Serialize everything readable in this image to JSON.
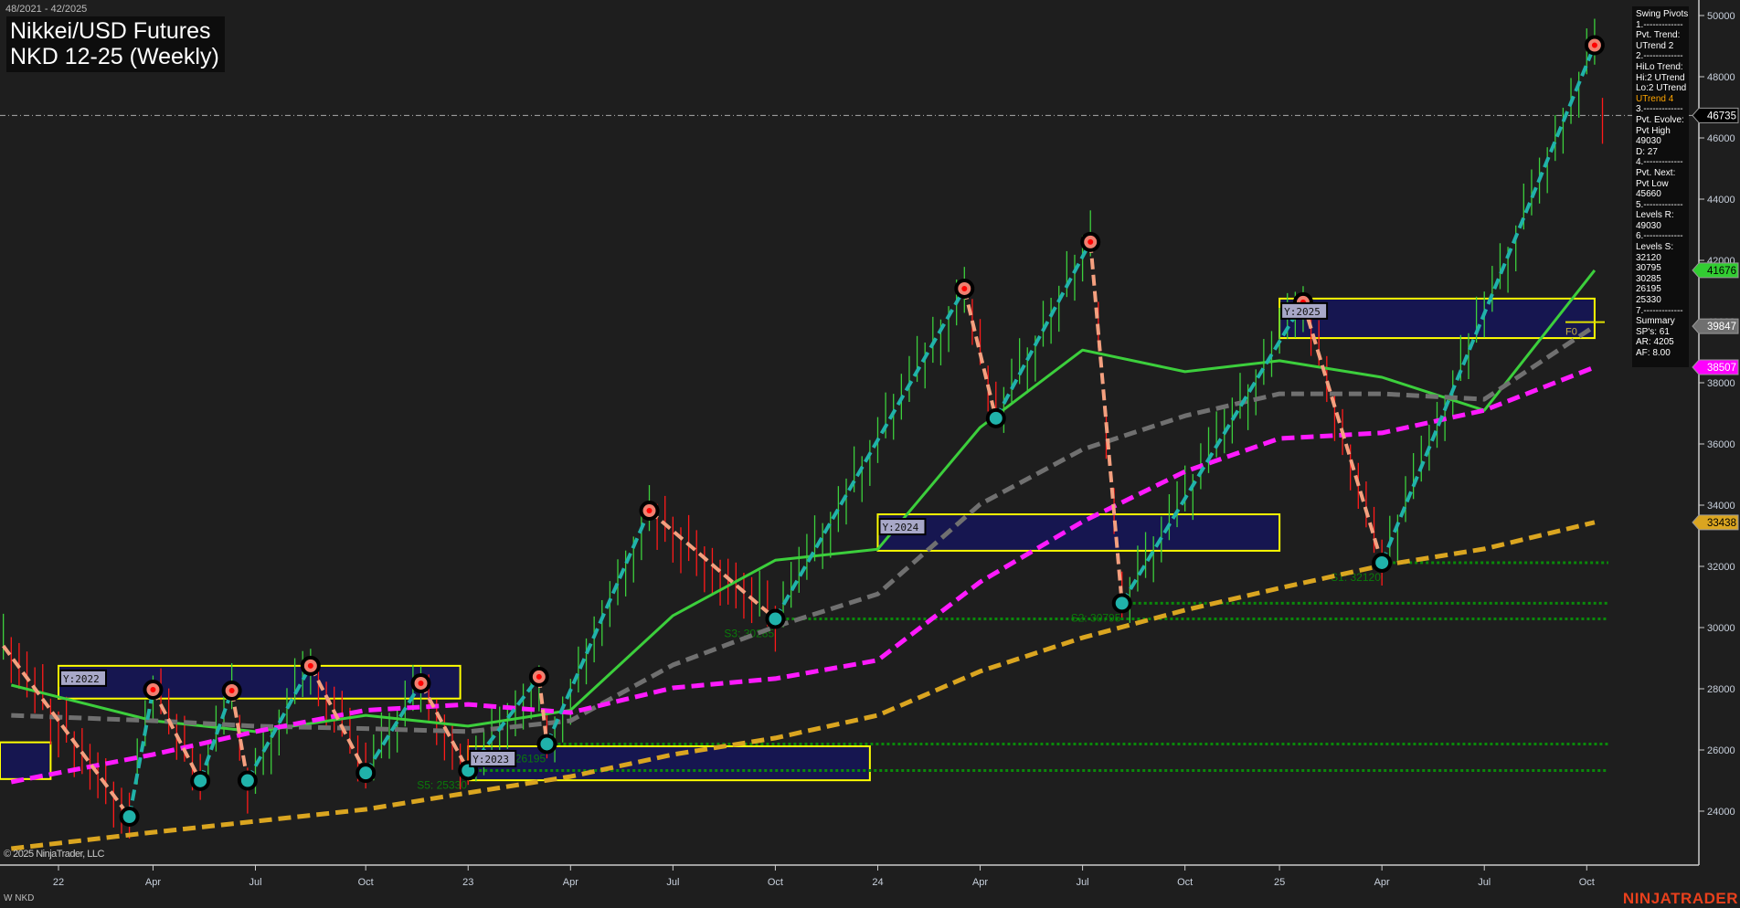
{
  "header": {
    "date_range": "48/2021 - 42/2025",
    "title_line1": "Nikkei/USD Futures",
    "title_line2": "NKD 12-25 (Weekly)"
  },
  "panel": {
    "lines": [
      "Swing Pivots",
      "1.-------------",
      "Pvt. Trend:",
      "UTrend 2",
      "2.-------------",
      "HiLo Trend:",
      "Hi:2 UTrend",
      "Lo:2 UTrend",
      "UTrend 4",
      "3.-------------",
      "Pvt. Evolve:",
      "Pvt High",
      "49030",
      "D: 27",
      "4.-------------",
      "Pvt. Next:",
      "Pvt Low",
      "45660",
      "5.-------------",
      "Levels R:",
      "49030",
      "6.-------------",
      "Levels S:",
      "32120",
      "30795",
      "30285",
      "26195",
      "25330",
      "7.-------------",
      "Summary",
      "SP's: 61",
      "AR: 4205",
      "AF: 8.00"
    ],
    "highlight_index": 8,
    "highlight_color": "#ffa500"
  },
  "footer": {
    "copyright": "© 2025 NinjaTrader, LLC",
    "instrument": "W NKD",
    "brand": "NINJATRADER"
  },
  "chart_data": {
    "type": "line",
    "title": "Nikkei/USD Futures NKD 12-25 (Weekly)",
    "x_unit": "weeks since Jan 2022",
    "ylim": [
      22500,
      50500
    ],
    "grid": false,
    "y_ticks": [
      24000,
      26000,
      28000,
      30000,
      32000,
      34000,
      36000,
      38000,
      40000,
      42000,
      44000,
      46000,
      48000,
      50000
    ],
    "x_ticks": [
      {
        "label": "22",
        "week": 0
      },
      {
        "label": "Apr",
        "week": 12
      },
      {
        "label": "Jul",
        "week": 25
      },
      {
        "label": "Oct",
        "week": 39
      },
      {
        "label": "23",
        "week": 52
      },
      {
        "label": "Apr",
        "week": 65
      },
      {
        "label": "Jul",
        "week": 78
      },
      {
        "label": "Oct",
        "week": 91
      },
      {
        "label": "24",
        "week": 104
      },
      {
        "label": "Apr",
        "week": 117
      },
      {
        "label": "Jul",
        "week": 130
      },
      {
        "label": "Oct",
        "week": 143
      },
      {
        "label": "25",
        "week": 155
      },
      {
        "label": "Apr",
        "week": 168
      },
      {
        "label": "Jul",
        "week": 181
      },
      {
        "label": "Oct",
        "week": 194
      }
    ],
    "last_price": 46735,
    "price_tags": [
      {
        "name": "last-price",
        "value": 46735,
        "bg": "#000000",
        "fg": "#ffffff"
      },
      {
        "name": "green-ma",
        "value": 41676,
        "bg": "#32cd32",
        "fg": "#000000"
      },
      {
        "name": "gray-ma",
        "value": 39847,
        "bg": "#707070",
        "fg": "#ffffff"
      },
      {
        "name": "magenta-ma",
        "value": 38507,
        "bg": "#ff00ff",
        "fg": "#ffffff"
      },
      {
        "name": "gold-ma",
        "value": 33438,
        "bg": "#daa520",
        "fg": "#000000"
      }
    ],
    "swing_pivots": [
      {
        "week": -7,
        "price": 29400,
        "type": "start"
      },
      {
        "week": 9,
        "price": 23820,
        "type": "low"
      },
      {
        "week": 12,
        "price": 27970,
        "type": "high"
      },
      {
        "week": 18,
        "price": 24990,
        "type": "low"
      },
      {
        "week": 22,
        "price": 27940,
        "type": "high"
      },
      {
        "week": 24,
        "price": 25000,
        "type": "low"
      },
      {
        "week": 32,
        "price": 28750,
        "type": "high"
      },
      {
        "week": 39,
        "price": 25250,
        "type": "low"
      },
      {
        "week": 46,
        "price": 28180,
        "type": "high"
      },
      {
        "week": 52,
        "price": 25330,
        "type": "low"
      },
      {
        "week": 61,
        "price": 28390,
        "type": "high"
      },
      {
        "week": 62,
        "price": 26195,
        "type": "low"
      },
      {
        "week": 75,
        "price": 33820,
        "type": "high"
      },
      {
        "week": 91,
        "price": 30285,
        "type": "low"
      },
      {
        "week": 115,
        "price": 41075,
        "type": "high"
      },
      {
        "week": 119,
        "price": 36840,
        "type": "low"
      },
      {
        "week": 131,
        "price": 42600,
        "type": "high"
      },
      {
        "week": 135,
        "price": 30795,
        "type": "low"
      },
      {
        "week": 158,
        "price": 40630,
        "type": "high"
      },
      {
        "week": 168,
        "price": 32120,
        "type": "low"
      },
      {
        "week": 195,
        "price": 49030,
        "type": "high"
      },
      {
        "week": 196,
        "price": 46735,
        "type": "end"
      }
    ],
    "ma_weeks": [
      -6,
      12,
      25,
      39,
      52,
      65,
      78,
      91,
      104,
      117,
      130,
      143,
      155,
      168,
      181,
      195
    ],
    "series": [
      {
        "name": "green-ma",
        "color": "#3ccf3c",
        "style": "solid",
        "values": [
          28120,
          26955,
          26600,
          27130,
          26780,
          27300,
          30390,
          32200,
          32560,
          36540,
          39070,
          38360,
          38720,
          38180,
          37100,
          41676
        ]
      },
      {
        "name": "gray-ma",
        "color": "#707070",
        "style": "dashed",
        "values": [
          27130,
          26955,
          26780,
          26700,
          26600,
          26955,
          28780,
          30030,
          31100,
          34030,
          35820,
          36920,
          37640,
          37640,
          37460,
          39847
        ]
      },
      {
        "name": "magenta-ma",
        "color": "#ff1aff",
        "style": "dashed",
        "values": [
          24955,
          25850,
          26600,
          27300,
          27490,
          27220,
          28030,
          28330,
          28930,
          31490,
          33460,
          35100,
          36180,
          36360,
          37100,
          38507
        ]
      },
      {
        "name": "gold-ma",
        "color": "#daa520",
        "style": "dashed",
        "values": [
          22776,
          23310,
          23670,
          24060,
          24600,
          25130,
          25850,
          26390,
          27130,
          28570,
          29670,
          30570,
          31290,
          32030,
          32570,
          33438
        ]
      }
    ],
    "year_boxes": [
      {
        "label": "",
        "week_start": -8,
        "week_end": -1,
        "high": 26250,
        "low": 25050
      },
      {
        "label": "Y:2022",
        "week_start": 0,
        "week_end": 51,
        "high": 28750,
        "low": 27680
      },
      {
        "label": "Y:2023",
        "week_start": 52,
        "week_end": 103,
        "high": 26120,
        "low": 25010
      },
      {
        "label": "Y:2024",
        "week_start": 104,
        "week_end": 155,
        "high": 33700,
        "low": 32510
      },
      {
        "label": "Y:2025",
        "week_start": 155,
        "week_end": 195,
        "high": 40750,
        "low": 39460
      }
    ],
    "support_levels": [
      {
        "label": "S1: 32120",
        "value": 32120,
        "from_week": 168
      },
      {
        "label": "S2: 30795",
        "value": 30795,
        "from_week": 135
      },
      {
        "label": "S3: 30285",
        "value": 30285,
        "from_week": 91
      },
      {
        "label": "S4: 26195",
        "value": 26195,
        "from_week": 62
      },
      {
        "label": "S5: 25330",
        "value": 25330,
        "from_week": 52
      }
    ],
    "f0_label": "F0",
    "f0_price": 39980
  }
}
